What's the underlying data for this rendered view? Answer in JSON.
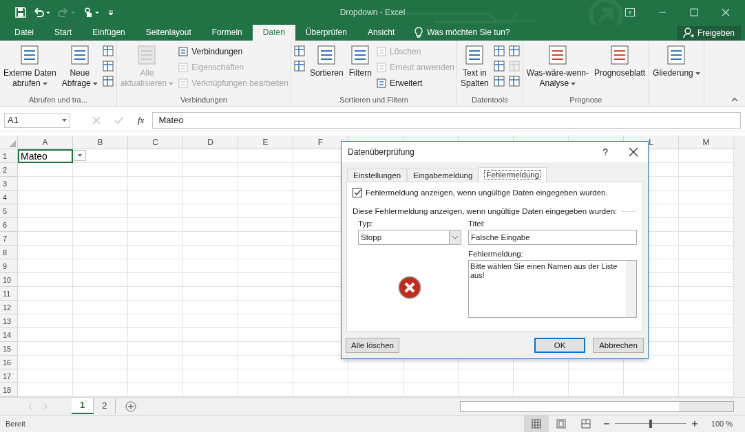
{
  "title_bar": {
    "title": "Dropdown - Excel"
  },
  "ribbon_tabs": [
    {
      "label": "Datei",
      "selected": false
    },
    {
      "label": "Start",
      "selected": false
    },
    {
      "label": "Einfügen",
      "selected": false
    },
    {
      "label": "Seitenlayout",
      "selected": false
    },
    {
      "label": "Formeln",
      "selected": false
    },
    {
      "label": "Daten",
      "selected": true
    },
    {
      "label": "Überprüfen",
      "selected": false
    },
    {
      "label": "Ansicht",
      "selected": false
    }
  ],
  "tell_me": {
    "placeholder": "Was möchten Sie tun?"
  },
  "share_button": {
    "label": "Freigeben"
  },
  "ribbon_groups": [
    {
      "label": "Abrufen und tra...",
      "items": [
        {
          "kind": "large",
          "lines": [
            "Externe Daten",
            "abrufen"
          ],
          "dropdown": true,
          "disabled": false
        },
        {
          "kind": "large",
          "lines": [
            "Neue",
            "Abfrage"
          ],
          "dropdown": true,
          "disabled": false
        },
        {
          "kind": "icon",
          "disabled": false
        },
        {
          "kind": "icon",
          "disabled": false
        },
        {
          "kind": "icon",
          "disabled": false
        }
      ]
    },
    {
      "label": "Verbindungen",
      "items": [
        {
          "kind": "large",
          "lines": [
            "Alle",
            "aktualisieren"
          ],
          "dropdown": true,
          "disabled": true
        },
        {
          "kind": "small",
          "label": "Verbindungen",
          "disabled": false
        },
        {
          "kind": "small",
          "label": "Eigenschaften",
          "disabled": true
        },
        {
          "kind": "small",
          "label": "Verknüpfungen bearbeiten",
          "disabled": true
        }
      ]
    },
    {
      "label": "Sortieren und Filtern",
      "items": [
        {
          "kind": "icon",
          "disabled": false
        },
        {
          "kind": "icon",
          "disabled": false
        },
        {
          "kind": "large",
          "lines": [
            "Sortieren"
          ],
          "dropdown": false,
          "disabled": false
        },
        {
          "kind": "large",
          "lines": [
            "Filtern"
          ],
          "dropdown": false,
          "disabled": false
        },
        {
          "kind": "small",
          "label": "Löschen",
          "disabled": true
        },
        {
          "kind": "small",
          "label": "Erneut anwenden",
          "disabled": true
        },
        {
          "kind": "small",
          "label": "Erweitert",
          "disabled": false
        }
      ]
    },
    {
      "label": "Datentools",
      "items": [
        {
          "kind": "large",
          "lines": [
            "Text in",
            "Spalten"
          ],
          "dropdown": false,
          "disabled": false
        },
        {
          "kind": "icon",
          "disabled": false
        },
        {
          "kind": "icon",
          "disabled": false
        },
        {
          "kind": "icon",
          "disabled": false
        },
        {
          "kind": "icon",
          "disabled": false
        },
        {
          "kind": "icon",
          "disabled": true
        },
        {
          "kind": "icon",
          "disabled": false
        }
      ]
    },
    {
      "label": "Prognose",
      "items": [
        {
          "kind": "large",
          "lines": [
            "Was-wäre-wenn-",
            "Analyse"
          ],
          "dropdown": true,
          "disabled": false
        },
        {
          "kind": "large",
          "lines": [
            "Prognoseblatt"
          ],
          "dropdown": false,
          "disabled": false
        }
      ]
    },
    {
      "items": [
        {
          "kind": "large",
          "lines": [
            "Gliederung"
          ],
          "dropdown": true,
          "disabled": false
        }
      ]
    }
  ],
  "formula_bar": {
    "name_box": "A1",
    "fx": "fx",
    "value": "Mateo"
  },
  "sheet": {
    "columns_left": [
      "A",
      "B",
      "C",
      "D",
      "E",
      "F"
    ],
    "columns_right": [
      "L",
      "M"
    ],
    "rows": [
      "1",
      "2",
      "3",
      "4",
      "5",
      "6",
      "7",
      "8",
      "9",
      "10",
      "11",
      "12",
      "13",
      "14",
      "15",
      "16",
      "17",
      "18"
    ],
    "active_cell": {
      "value": "Mateo"
    }
  },
  "sheet_tabs": [
    {
      "label": "1",
      "selected": true
    },
    {
      "label": "2",
      "selected": false
    }
  ],
  "status_bar": {
    "status": "Bereit",
    "views": [
      {
        "selected": true
      },
      {
        "selected": false
      },
      {
        "selected": false
      }
    ],
    "zoom": {
      "level": 0.5,
      "reading": "100 %"
    }
  },
  "dialog": {
    "title": "Datenüberprüfung",
    "help": "?",
    "tabs": [
      {
        "label": "Einstellungen",
        "selected": false
      },
      {
        "label": "Eingabemeldung",
        "selected": false
      },
      {
        "label": "Fehlermeldung",
        "selected": true
      }
    ],
    "show_error": {
      "label": "Fehlermeldung anzeigen, wenn ungültige Daten eingegeben wurden.",
      "checked": true
    },
    "section_label": "Diese Fehlermeldung anzeigen, wenn ungültige Daten eingegeben wurden:",
    "type": {
      "label": "Typ:",
      "value": "Stopp"
    },
    "title_field": {
      "label": "Titel:",
      "value": "Falsche Eingabe"
    },
    "message_field": {
      "label": "Fehlermeldung:",
      "value": "Bitte wählen Sie einen Namen aus der Liste aus!"
    },
    "buttons": [
      {
        "label": "Alle löschen",
        "kind": "secondary"
      },
      {
        "label": "OK",
        "kind": "default"
      },
      {
        "label": "Abbrechen",
        "kind": "secondary"
      }
    ]
  }
}
